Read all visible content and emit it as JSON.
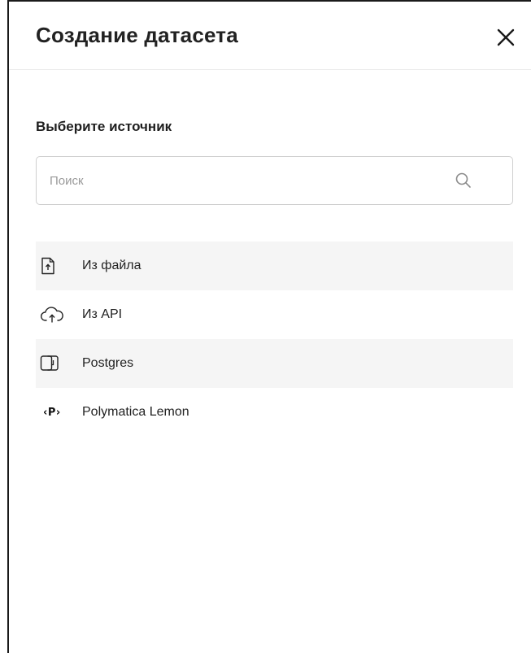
{
  "dialog": {
    "title": "Создание датасета",
    "close_icon": "close-icon"
  },
  "source": {
    "heading": "Выберите источник",
    "search": {
      "placeholder": "Поиск",
      "value": "",
      "icon": "search-icon"
    },
    "items": [
      {
        "label": "Из файла",
        "icon": "file-upload-icon",
        "shaded": true
      },
      {
        "label": "Из API",
        "icon": "cloud-upload-icon",
        "shaded": false
      },
      {
        "label": "Postgres",
        "icon": "database-icon",
        "shaded": true
      },
      {
        "label": "Polymatica Lemon",
        "icon": "polymatica-icon",
        "icon_text": "‹P›",
        "shaded": false
      }
    ]
  },
  "colors": {
    "row_shade": "#f5f5f5",
    "border": "#cfcfcf",
    "text": "#222222",
    "placeholder": "#9a9a9a"
  }
}
